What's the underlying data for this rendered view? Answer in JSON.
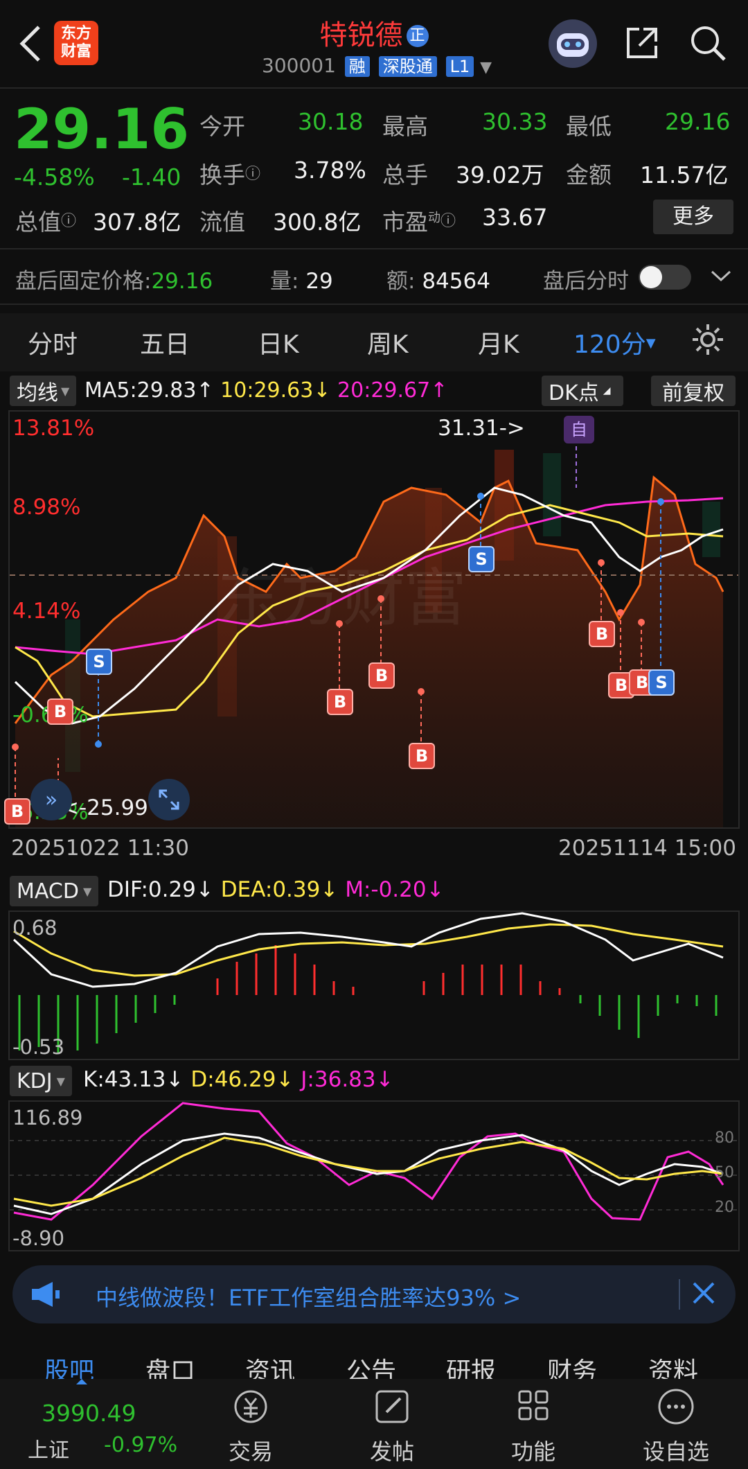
{
  "header": {
    "back_icon": "chevron-left-icon",
    "broker_logo_lines": [
      "东方",
      "财富"
    ],
    "stock_name": "特锐德",
    "name_badge": "正",
    "stock_code": "300001",
    "badges": [
      "融",
      "深股通",
      "L1"
    ],
    "robot_icon": "robot-avatar-icon",
    "share_icon": "share-icon",
    "search_icon": "search-icon"
  },
  "quote": {
    "price": "29.16",
    "change_pct": "-4.58%",
    "change_abs": "-1.40",
    "open_label": "今开",
    "open": "30.18",
    "high_label": "最高",
    "high": "30.33",
    "low_label": "最低",
    "low": "29.16",
    "turnover_label": "换手",
    "turnover": "3.78%",
    "volume_label": "总手",
    "volume": "39.02万",
    "amount_label": "金额",
    "amount": "11.57亿",
    "mktcap_label": "总值",
    "mktcap": "307.8亿",
    "float_label": "流值",
    "float_cap": "300.8亿",
    "pe_label": "市盈",
    "pe_sup": "动",
    "pe": "33.67",
    "more_button": "更多"
  },
  "after_hours": {
    "fixed_price_label": "盘后固定价格:",
    "fixed_price": "29.16",
    "volume_label": "量:",
    "volume": "29",
    "amount_label": "额:",
    "amount": "84564",
    "intraday_label": "盘后分时",
    "toggle_on": false
  },
  "period_tabs": [
    "分时",
    "五日",
    "日K",
    "周K",
    "月K",
    "120分"
  ],
  "active_period": "120分",
  "chart_toolbar": {
    "ma_select": "均线",
    "ma5": "MA5:29.83",
    "ma10": "10:29.63",
    "ma20": "20:29.67",
    "dk_button": "DK点",
    "adjust_button": "前复权"
  },
  "main_chart": {
    "y_labels": [
      "13.81%",
      "8.98%",
      "4.14%",
      "-0.67%",
      "-5.53%"
    ],
    "high_marker": "31.31->",
    "low_marker": "<-25.99",
    "self_marker": "自",
    "watermark": "东方财富",
    "start_time": "20251022 11:30",
    "end_time": "20251114 15:00"
  },
  "macd": {
    "select": "MACD",
    "dif": "DIF:0.29",
    "dea": "DEA:0.39",
    "m": "M:-0.20",
    "y_top": "0.68",
    "y_bottom": "-0.53"
  },
  "kdj": {
    "select": "KDJ",
    "k": "K:43.13",
    "d": "D:46.29",
    "j": "J:36.83",
    "y_top": "116.89",
    "y_bottom": "-8.90",
    "levels": [
      "80",
      "50",
      "20"
    ]
  },
  "banner": {
    "text": "中线做波段！ETF工作室组合胜率达93% >"
  },
  "bottom_tabs": [
    "股吧",
    "盘口",
    "资讯",
    "公告",
    "研报",
    "财务",
    "资料"
  ],
  "active_bottom_tab": "股吧",
  "index": {
    "name": "上证",
    "value": "3990.49",
    "change": "-0.97%"
  },
  "nav": [
    {
      "label": "交易",
      "icon": "trade-yen-icon"
    },
    {
      "label": "发帖",
      "icon": "compose-icon"
    },
    {
      "label": "功能",
      "icon": "grid-icon"
    },
    {
      "label": "设自选",
      "icon": "more-circle-icon"
    }
  ],
  "colors": {
    "up": "#ff2e2e",
    "down": "#2fc12f",
    "accent_blue": "#3d8cf0",
    "ma5": "#ffffff",
    "ma10": "#ffe84a",
    "ma20": "#ff2bd6",
    "price_line": "#ff6a1a"
  }
}
